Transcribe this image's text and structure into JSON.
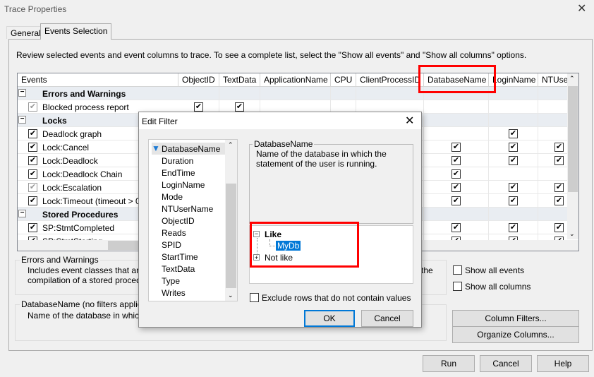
{
  "window": {
    "title": "Trace Properties",
    "close_icon": "close-icon"
  },
  "tabs": [
    {
      "label": "General"
    },
    {
      "label": "Events Selection",
      "active": true
    }
  ],
  "instructions": "Review selected events and event columns to trace. To see a complete list, select the \"Show all events\" and \"Show all columns\" options.",
  "grid": {
    "columns": [
      "Events",
      "ObjectID",
      "TextData",
      "ApplicationName",
      "CPU",
      "ClientProcessID",
      "DatabaseName",
      "LoginName",
      "NTUserName"
    ],
    "rows": [
      {
        "category": true,
        "label": "Errors and Warnings"
      },
      {
        "label": "Blocked process report",
        "checked": true,
        "disabled": true,
        "cols": [
          "ObjectID",
          "TextData"
        ]
      },
      {
        "category": true,
        "label": "Locks"
      },
      {
        "label": "Deadlock graph",
        "checked": true,
        "cols": [
          "LoginName"
        ]
      },
      {
        "label": "Lock:Cancel",
        "checked": true,
        "cols": [
          "DatabaseName",
          "LoginName",
          "NTUserName"
        ]
      },
      {
        "label": "Lock:Deadlock",
        "checked": true,
        "cols": [
          "DatabaseName",
          "LoginName",
          "NTUserName"
        ]
      },
      {
        "label": "Lock:Deadlock Chain",
        "checked": true,
        "cols": [
          "DatabaseName"
        ]
      },
      {
        "label": "Lock:Escalation",
        "checked": true,
        "disabled": true,
        "cols": [
          "DatabaseName",
          "LoginName",
          "NTUserName"
        ]
      },
      {
        "label": "Lock:Timeout (timeout > 0)",
        "checked": true,
        "cols": [
          "DatabaseName",
          "LoginName",
          "NTUserName"
        ]
      },
      {
        "category": true,
        "label": "Stored Procedures"
      },
      {
        "label": "SP:StmtCompleted",
        "checked": true,
        "cols": [
          "DatabaseName",
          "LoginName",
          "NTUserName"
        ]
      },
      {
        "label": "SP:StmtStarting",
        "checked": true,
        "cols": [
          "DatabaseName",
          "LoginName",
          "NTUserName"
        ]
      }
    ]
  },
  "event_desc": {
    "title": "Errors and Warnings",
    "text1": "Includes event classes that are pr",
    "text2": "compilation of a stored procedure",
    "text_right": "the"
  },
  "column_desc": {
    "title": "DatabaseName (no filters applied)",
    "text": "Name of the database in which th"
  },
  "options": {
    "show_all_events": "Show all events",
    "show_all_columns": "Show all columns"
  },
  "buttons": {
    "column_filters": "Column Filters...",
    "organize_columns": "Organize Columns...",
    "run": "Run",
    "cancel": "Cancel",
    "help": "Help"
  },
  "edit_filter": {
    "title": "Edit Filter",
    "columns": [
      "DatabaseName",
      "Duration",
      "EndTime",
      "LoginName",
      "Mode",
      "NTUserName",
      "ObjectID",
      "Reads",
      "SPID",
      "StartTime",
      "TextData",
      "Type",
      "Writes"
    ],
    "selected_column": "DatabaseName",
    "desc_title": "DatabaseName",
    "desc_text": "Name of the database in which the statement of the user is running.",
    "tree": {
      "like": "Like",
      "like_value": "MyDb",
      "not_like": "Not like"
    },
    "exclude_label": "Exclude rows that do not contain values",
    "ok": "OK",
    "cancel": "Cancel"
  },
  "colors": {
    "highlight": "#0078d7",
    "annotation": "#ff0000",
    "category_row": "#e9edf2"
  }
}
